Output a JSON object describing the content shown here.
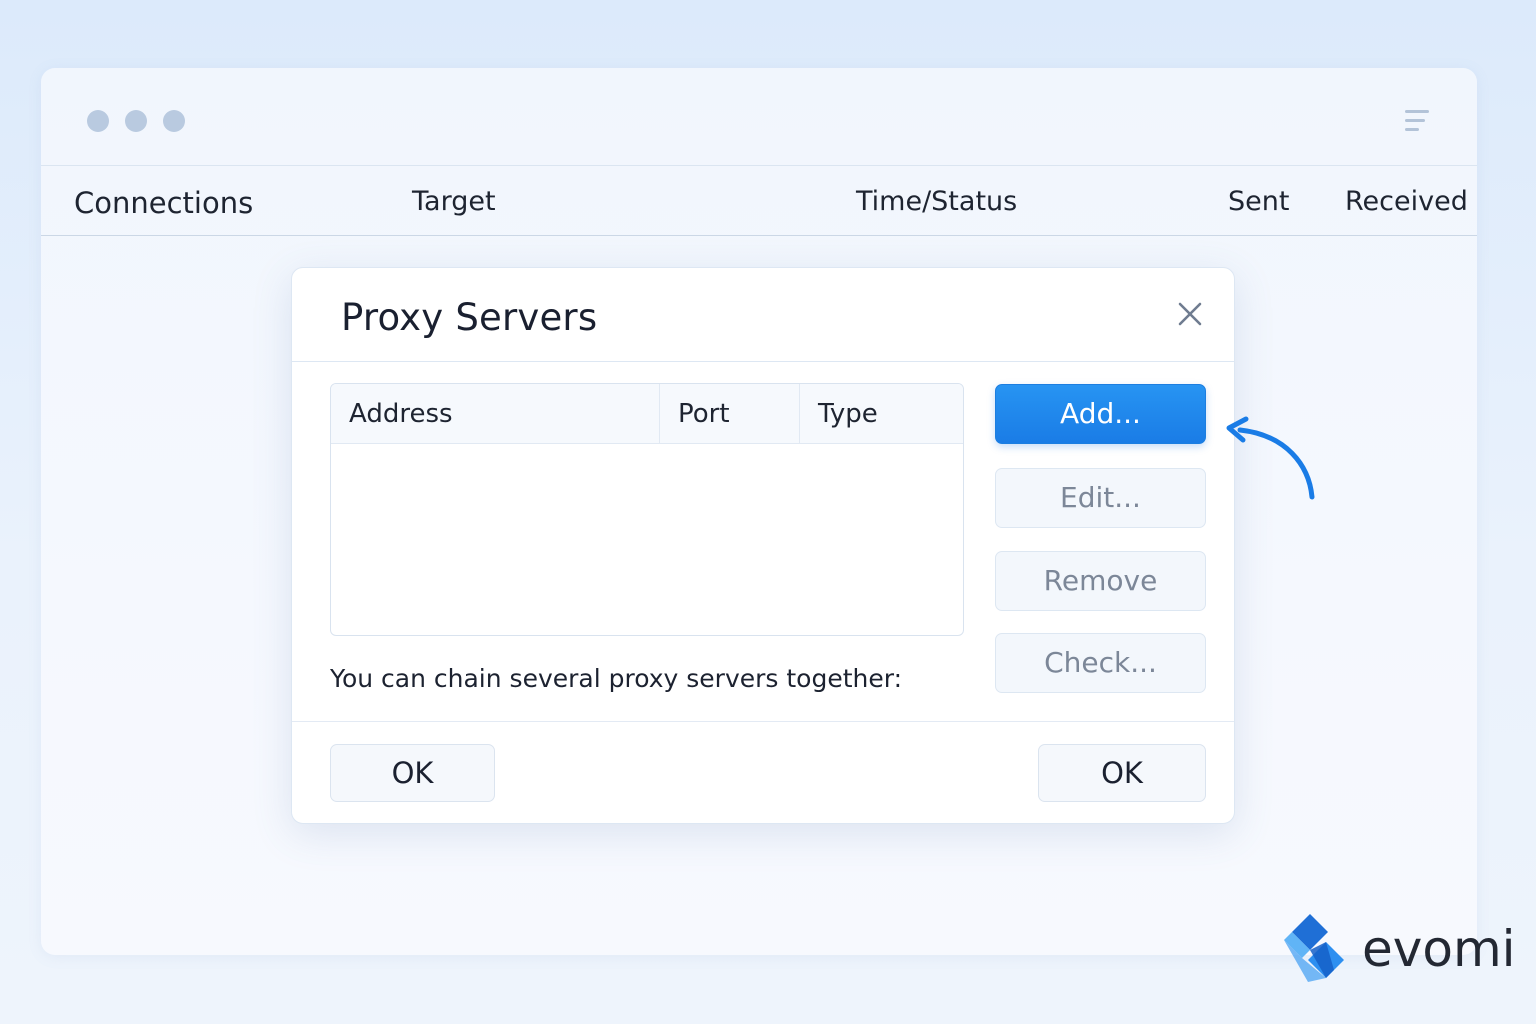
{
  "window": {
    "columns": {
      "connections": "Connections",
      "target": "Target",
      "time_status": "Time/Status",
      "sent": "Sent",
      "received": "Received"
    },
    "controls": {
      "dot_icons": [
        "window-dot-icon",
        "window-dot-icon",
        "window-dot-icon"
      ],
      "menu_icon": "menu-lines-icon"
    }
  },
  "dialog": {
    "title": "Proxy Servers",
    "close_icon": "close-icon",
    "table": {
      "headers": [
        "Address",
        "Port",
        "Type"
      ],
      "rows": []
    },
    "note": "You can chain several proxy servers together:",
    "buttons": {
      "add": "Add...",
      "edit": "Edit...",
      "remove": "Remove",
      "check": "Check..."
    },
    "footer": {
      "ok_left": "OK",
      "ok_right": "OK"
    }
  },
  "annotation": {
    "arrow_icon": "curved-arrow-icon",
    "color": "#1a7ce6"
  },
  "brand": {
    "name": "evomi",
    "logo_icon": "evomi-logo-icon"
  },
  "colors": {
    "accent": "#1a7ce6",
    "background": "#dceafb",
    "dialog": "#ffffff"
  }
}
